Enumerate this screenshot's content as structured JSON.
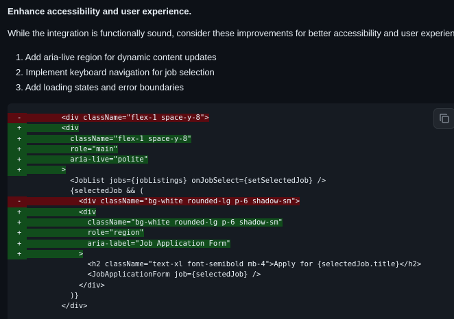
{
  "heading": "Enhance accessibility and user experience.",
  "intro": "While the integration is functionally sound, consider these improvements for better accessibility and user experience:",
  "list": [
    "1. Add aria-live region for dynamic content updates",
    "2. Implement keyboard navigation for job selection",
    "3. Add loading states and error boundaries"
  ],
  "copy_icon": "copy-icon",
  "colors": {
    "background": "#0d1117",
    "code_background": "#161b22",
    "deletion": "#5c0a10",
    "addition": "#114d1c"
  },
  "code": [
    {
      "type": "del",
      "sign": "-",
      "indent": "        ",
      "text": "<div className=\"flex-1 space-y-8\">"
    },
    {
      "type": "add",
      "sign": "+",
      "indent": "        ",
      "text": "<div"
    },
    {
      "type": "add",
      "sign": "+",
      "indent": "          ",
      "text": "className=\"flex-1 space-y-8\""
    },
    {
      "type": "add",
      "sign": "+",
      "indent": "          ",
      "text": "role=\"main\""
    },
    {
      "type": "add",
      "sign": "+",
      "indent": "          ",
      "text": "aria-live=\"polite\""
    },
    {
      "type": "add",
      "sign": "+",
      "indent": "        ",
      "text": ">"
    },
    {
      "type": "ctx",
      "sign": " ",
      "indent": "          ",
      "text": "<JobList jobs={jobListings} onJobSelect={setSelectedJob} />"
    },
    {
      "type": "ctx",
      "sign": " ",
      "indent": "          ",
      "text": "{selectedJob && ("
    },
    {
      "type": "del",
      "sign": "-",
      "indent": "            ",
      "text": "<div className=\"bg-white rounded-lg p-6 shadow-sm\">"
    },
    {
      "type": "add",
      "sign": "+",
      "indent": "            ",
      "text": "<div"
    },
    {
      "type": "add",
      "sign": "+",
      "indent": "              ",
      "text": "className=\"bg-white rounded-lg p-6 shadow-sm\""
    },
    {
      "type": "add",
      "sign": "+",
      "indent": "              ",
      "text": "role=\"region\""
    },
    {
      "type": "add",
      "sign": "+",
      "indent": "              ",
      "text": "aria-label=\"Job Application Form\""
    },
    {
      "type": "add",
      "sign": "+",
      "indent": "            ",
      "text": ">"
    },
    {
      "type": "ctx",
      "sign": " ",
      "indent": "              ",
      "text": "<h2 className=\"text-xl font-semibold mb-4\">Apply for {selectedJob.title}</h2>"
    },
    {
      "type": "ctx",
      "sign": " ",
      "indent": "              ",
      "text": "<JobApplicationForm job={selectedJob} />"
    },
    {
      "type": "ctx",
      "sign": " ",
      "indent": "            ",
      "text": "</div>"
    },
    {
      "type": "ctx",
      "sign": " ",
      "indent": "          ",
      "text": ")}"
    },
    {
      "type": "ctx",
      "sign": " ",
      "indent": "        ",
      "text": "</div>"
    }
  ]
}
